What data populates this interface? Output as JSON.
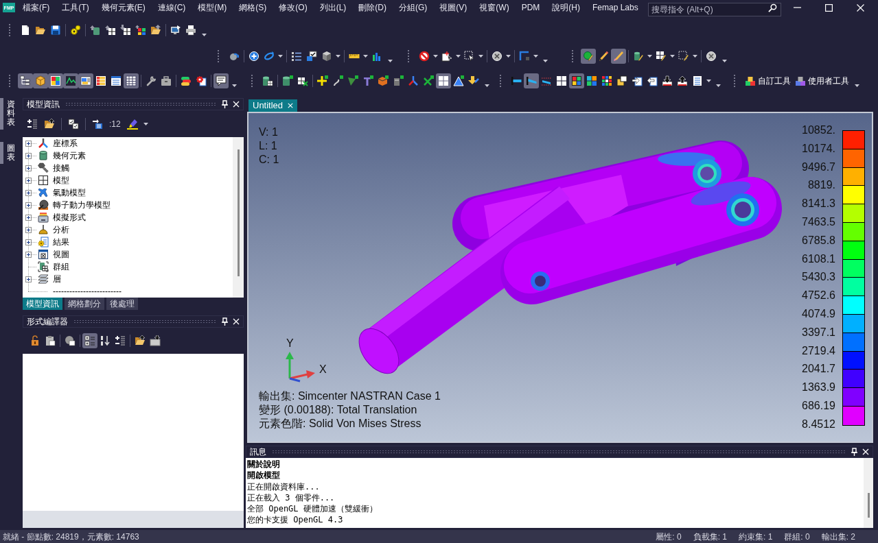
{
  "app_logo": "FMP",
  "menu": [
    "檔案(F)",
    "工具(T)",
    "幾何元素(E)",
    "連線(C)",
    "模型(M)",
    "網格(S)",
    "修改(O)",
    "列出(L)",
    "刪除(D)",
    "分組(G)",
    "視圖(V)",
    "視窗(W)",
    "PDM",
    "說明(H)",
    "Femap Labs"
  ],
  "search": {
    "placeholder": "搜尋指令 (Alt+Q)"
  },
  "toolbars": [
    {
      "buttons": [
        {
          "on": false
        },
        {
          "on": false
        },
        {
          "on": false
        },
        {
          "on": false
        },
        {
          "on": false
        },
        {
          "on": false
        },
        {
          "on": false
        },
        {
          "on": false
        },
        {
          "on": false
        },
        {
          "on": false
        },
        {
          "on": false
        }
      ]
    },
    {
      "buttons": [
        {
          "on": false
        },
        {
          "on": false
        },
        {
          "on": false
        },
        {
          "on": false
        },
        {
          "on": false
        },
        {
          "on": false
        },
        {
          "on": false
        },
        {
          "on": false
        }
      ]
    },
    {
      "buttons": [
        {
          "on": false
        },
        {
          "on": false
        },
        {
          "on": false
        },
        {
          "on": false
        },
        {
          "on": false
        }
      ]
    },
    {
      "buttons": [
        {
          "on": true
        },
        {
          "on": false
        },
        {
          "on": true
        },
        {
          "on": false
        },
        {
          "on": false
        },
        {
          "on": false
        },
        {
          "on": false
        }
      ]
    },
    {
      "buttons": [
        {
          "on": true
        },
        {
          "on": true
        },
        {
          "on": true
        },
        {
          "on": true
        },
        {
          "on": true
        },
        {
          "on": false
        },
        {
          "on": false
        },
        {
          "on": true
        },
        {
          "on": false
        },
        {
          "on": false
        },
        {
          "on": false
        },
        {
          "on": false
        },
        {
          "on": true
        }
      ]
    },
    {
      "buttons": [
        {
          "on": false
        },
        {
          "on": false
        },
        {
          "on": false
        },
        {
          "on": false
        },
        {
          "on": false
        },
        {
          "on": false
        },
        {
          "on": false
        },
        {
          "on": false
        },
        {
          "on": false
        },
        {
          "on": false
        },
        {
          "on": false
        },
        {
          "on": true
        },
        {
          "on": false
        },
        {
          "on": false
        }
      ]
    },
    {
      "buttons": [
        {
          "on": false
        },
        {
          "on": true
        },
        {
          "on": false
        },
        {
          "on": false
        },
        {
          "on": true
        },
        {
          "on": false
        },
        {
          "on": false
        },
        {
          "on": false
        },
        {
          "on": false
        },
        {
          "on": false
        },
        {
          "on": false
        },
        {
          "on": false
        },
        {
          "on": false
        }
      ]
    },
    {
      "buttons": [
        {
          "on": false,
          "label": "自訂工具"
        },
        {
          "on": false,
          "label": "使用者工具"
        }
      ]
    }
  ],
  "side_tabs": [
    {
      "label": "資料表"
    },
    {
      "label": "圖表"
    }
  ],
  "model_info": {
    "title": "模型資訊",
    "toolbar": [
      {
        "on": false
      },
      {
        "on": false
      },
      {
        "on": false
      },
      {
        "on": false
      },
      {
        "on": false,
        "label": ":12"
      },
      {
        "on": false
      }
    ],
    "tree": [
      {
        "kind": "node",
        "label": "座標系",
        "expanded": false
      },
      {
        "kind": "node",
        "label": "幾何元素",
        "expanded": false
      },
      {
        "kind": "node",
        "label": "接觸",
        "expanded": false
      },
      {
        "kind": "node",
        "label": "模型",
        "expanded": false
      },
      {
        "kind": "node",
        "label": "氣動模型",
        "expanded": false
      },
      {
        "kind": "node",
        "label": "轉子動力學模型",
        "expanded": false
      },
      {
        "kind": "node",
        "label": "模擬形式",
        "expanded": false
      },
      {
        "kind": "node",
        "label": "分析",
        "expanded": false
      },
      {
        "kind": "node",
        "label": "結果",
        "expanded": false
      },
      {
        "kind": "node",
        "label": "視圖",
        "expanded": false
      },
      {
        "kind": "leaf",
        "label": "群組"
      },
      {
        "kind": "node",
        "label": "層",
        "expanded": false
      },
      {
        "kind": "separator",
        "label": "-------------------------"
      }
    ],
    "tabs": [
      {
        "label": "模型資訊",
        "selected": true
      },
      {
        "label": "網格劃分",
        "selected": false
      },
      {
        "label": "後處理",
        "selected": false
      }
    ]
  },
  "shape_editor": {
    "title": "形式編譯器",
    "toolbar": [
      {
        "on": false
      },
      {
        "on": false
      },
      {
        "on": false
      },
      {
        "on": true
      },
      {
        "on": false
      },
      {
        "on": false
      },
      {
        "on": false
      },
      {
        "on": false
      }
    ]
  },
  "document_tabs": [
    {
      "label": "Untitled",
      "selected": true
    }
  ],
  "viewport": {
    "info": [
      "V: 1",
      "L: 1",
      "C: 1"
    ],
    "triad": {
      "y_label": "Y",
      "x_label": "X"
    },
    "captions": [
      "輸出集: Simcenter NASTRAN Case 1",
      "變形 (0.00188): Total Translation",
      "元素色階: Solid Von Mises Stress"
    ],
    "legend": {
      "labels": [
        "10852.",
        "10174.",
        "9496.7",
        "8819.",
        "8141.3",
        "7463.5",
        "6785.8",
        "6108.1",
        "5430.3",
        "4752.6",
        "4074.9",
        "3397.1",
        "2719.4",
        "2041.7",
        "1363.9",
        "686.19",
        "8.4512"
      ],
      "bands": [
        {
          "color": "#ff2000"
        },
        {
          "color": "#ff6400"
        },
        {
          "color": "#ffb000"
        },
        {
          "color": "#ffff00"
        },
        {
          "color": "#b4ff00"
        },
        {
          "color": "#64ff00"
        },
        {
          "color": "#00ff10"
        },
        {
          "color": "#00ff60"
        },
        {
          "color": "#00ffa0"
        },
        {
          "color": "#00ffff"
        },
        {
          "color": "#00b0ff"
        },
        {
          "color": "#0070ff"
        },
        {
          "color": "#0010ff"
        },
        {
          "color": "#4000ff"
        },
        {
          "color": "#8000ff"
        },
        {
          "color": "#e000ff"
        }
      ]
    }
  },
  "messages": {
    "title": "訊息",
    "lines": [
      {
        "kind": "heading",
        "text": "關於說明"
      },
      {
        "kind": "heading",
        "text": "開啟模型"
      },
      {
        "kind": "info",
        "text": "正在開啟資料庫..."
      },
      {
        "kind": "info",
        "text": "正在載入 3 個零件..."
      },
      {
        "kind": "info",
        "text": "全部 OpenGL 硬體加速（雙緩衝）"
      },
      {
        "kind": "info",
        "text": "您的卡支援 OpenGL 4.3"
      }
    ]
  },
  "status_bar": {
    "text": "就緒 - 節點數: 24819，元素數: 14763",
    "counters": [
      "屬性: 0",
      "負載集: 1",
      "約束集: 1",
      "群組: 0",
      "輸出集: 2"
    ]
  }
}
